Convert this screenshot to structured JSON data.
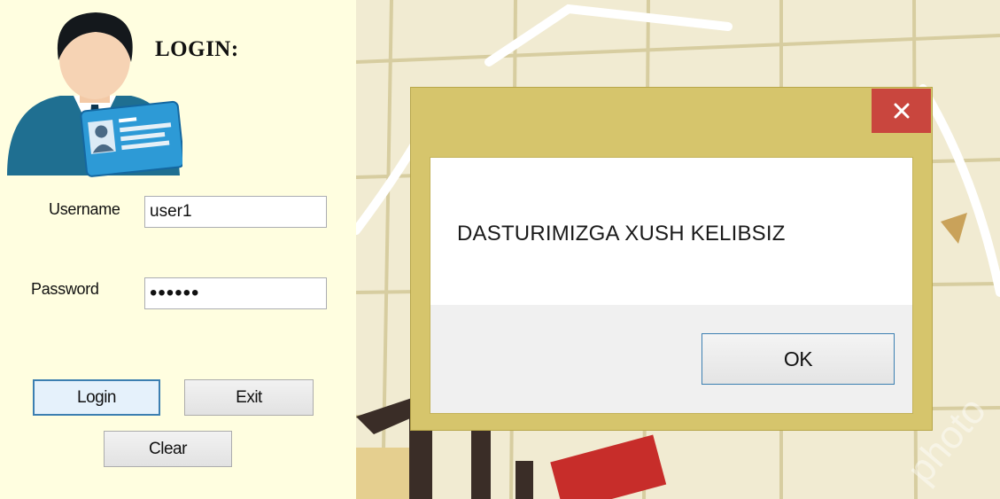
{
  "login": {
    "title": "LOGIN:",
    "username_label": "Username",
    "username_value": "user1",
    "password_label": "Password",
    "password_value": "••••••",
    "login_button": "Login",
    "exit_button": "Exit",
    "clear_button": "Clear",
    "avatar_icon": "user-id-card-icon"
  },
  "dialog": {
    "message": "DASTURIMIZGA XUSH KELIBSIZ",
    "ok_button": "OK",
    "close_icon": "close-icon"
  },
  "colors": {
    "panel_bg": "#fffee0",
    "dialog_frame": "#d6c56c",
    "close_red": "#c9463e",
    "focus_blue": "#3c7fb1"
  }
}
